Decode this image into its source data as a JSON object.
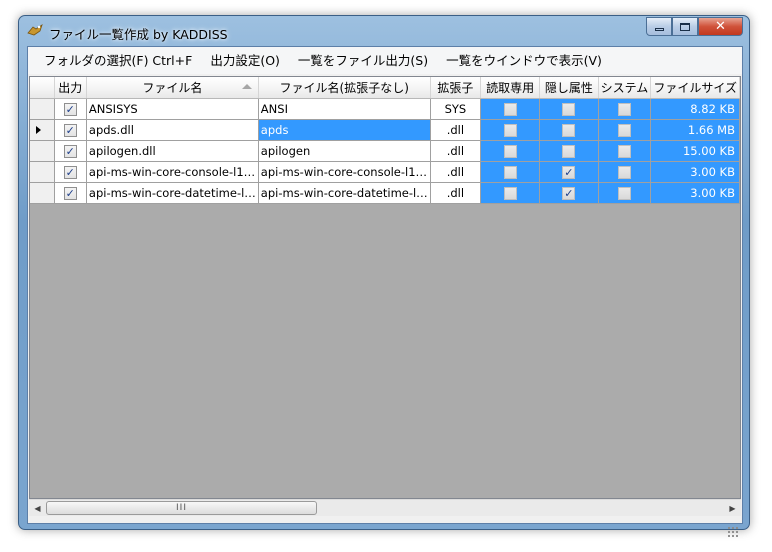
{
  "window": {
    "title": "ファイル一覧作成 by KADDISS",
    "minimize_label": "▭",
    "maximize_label": "□",
    "close_label": "✕"
  },
  "menu": {
    "items": [
      "フォルダの選択(F) Ctrl+F",
      "出力設定(O)",
      "一覧をファイル出力(S)",
      "一覧をウインドウで表示(V)"
    ]
  },
  "grid": {
    "columns": [
      "出力",
      "ファイル名",
      "ファイル名(拡張子なし)",
      "拡張子",
      "読取専用",
      "隠し属性",
      "システム",
      "ファイルサイズ"
    ],
    "sorted_column": "ファイル名",
    "rows": [
      {
        "output": true,
        "name": "ANSISYS",
        "basename": "ANSI",
        "ext": "SYS",
        "readonly": false,
        "hidden": false,
        "system": false,
        "size": "8.82 KB"
      },
      {
        "output": true,
        "name": "apds.dll",
        "basename": "apds",
        "ext": ".dll",
        "readonly": false,
        "hidden": false,
        "system": false,
        "size": "1.66 MB",
        "current": true
      },
      {
        "output": true,
        "name": "apilogen.dll",
        "basename": "apilogen",
        "ext": ".dll",
        "readonly": false,
        "hidden": false,
        "system": false,
        "size": "15.00 KB"
      },
      {
        "output": true,
        "name": "api-ms-win-core-console-l1…",
        "basename": "api-ms-win-core-console-l1…",
        "ext": ".dll",
        "readonly": false,
        "hidden": true,
        "system": false,
        "size": "3.00 KB"
      },
      {
        "output": true,
        "name": "api-ms-win-core-datetime-l…",
        "basename": "api-ms-win-core-datetime-l…",
        "ext": ".dll",
        "readonly": false,
        "hidden": true,
        "system": false,
        "size": "3.00 KB"
      }
    ]
  },
  "scrollbar": {
    "left_arrow": "◀",
    "right_arrow": "▶",
    "thumb_grip": "III"
  },
  "colors": {
    "selection": "#3399ff",
    "grid_empty": "#ababab"
  }
}
